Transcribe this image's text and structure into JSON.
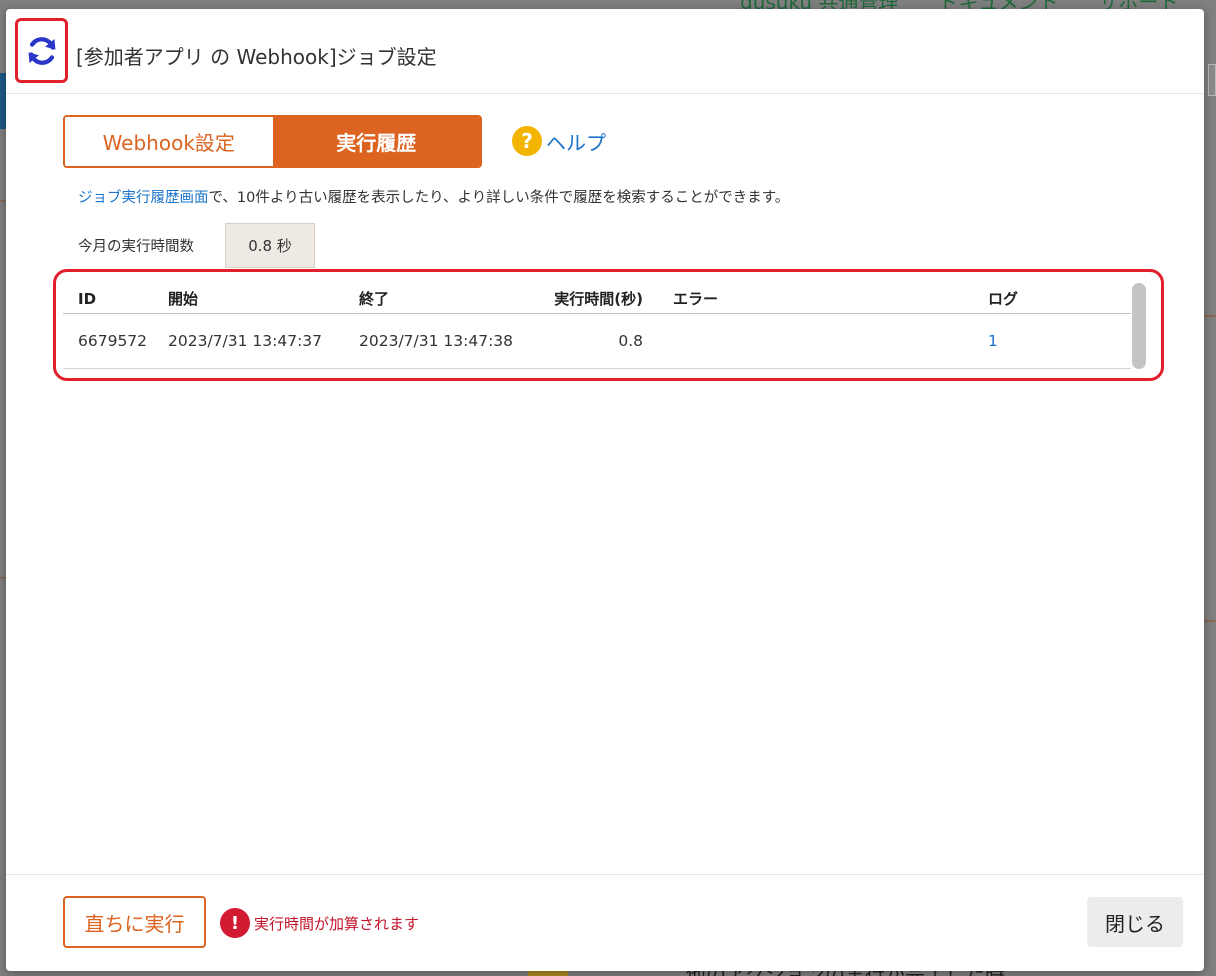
{
  "background": {
    "nav_items": [
      "gusuku 共通管理",
      "ドキュメント",
      "サポート"
    ],
    "bottom_text": "他のアクションの実行が完了した時"
  },
  "dialog": {
    "title": "[参加者アプリ の Webhook]ジョブ設定",
    "refresh_icon": "refresh-icon",
    "tabs": [
      {
        "label": "Webhook設定",
        "active": false
      },
      {
        "label": "実行履歴",
        "active": true
      }
    ],
    "help": {
      "icon": "question-circle-icon",
      "label": "ヘルプ"
    },
    "description": {
      "link_text": "ジョブ実行履歴画面",
      "rest_text": "で、10件より古い履歴を表示したり、より詳しい条件で履歴を検索することができます。"
    },
    "monthly": {
      "label": "今月の実行時間数",
      "value": "0.8 秒"
    },
    "history": {
      "columns": [
        "ID",
        "開始",
        "終了",
        "実行時間(秒)",
        "エラー",
        "ログ"
      ],
      "rows": [
        {
          "id": "6679572",
          "start": "2023/7/31 13:47:37",
          "end": "2023/7/31 13:47:38",
          "duration": "0.8",
          "error": "",
          "log": "1"
        }
      ]
    },
    "footer": {
      "run_label": "直ちに実行",
      "warning_icon": "exclamation-circle-icon",
      "warning_text": "実行時間が加算されます",
      "close_label": "閉じる"
    }
  },
  "colors": {
    "accent": "#dc6320",
    "link": "#1a73c9",
    "warning": "#d21a30",
    "highlight_frame": "#e0202a"
  }
}
